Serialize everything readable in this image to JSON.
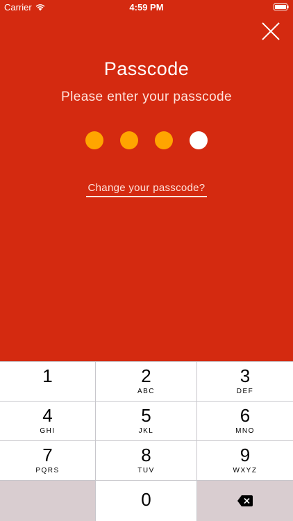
{
  "status_bar": {
    "carrier": "Carrier",
    "time": "4:59 PM"
  },
  "title": "Passcode",
  "subtitle": "Please enter your passcode",
  "passcode": {
    "length": 4,
    "entered": 3,
    "filled_color": "#FFA500",
    "empty_color": "#FFFFFF"
  },
  "change_link": "Change your passcode?",
  "colors": {
    "background": "#D42A10",
    "keypad_special": "#D9CDD0"
  },
  "keypad": {
    "keys": [
      {
        "num": "1",
        "letters": ""
      },
      {
        "num": "2",
        "letters": "ABC"
      },
      {
        "num": "3",
        "letters": "DEF"
      },
      {
        "num": "4",
        "letters": "GHI"
      },
      {
        "num": "5",
        "letters": "JKL"
      },
      {
        "num": "6",
        "letters": "MNO"
      },
      {
        "num": "7",
        "letters": "PQRS"
      },
      {
        "num": "8",
        "letters": "TUV"
      },
      {
        "num": "9",
        "letters": "WXYZ"
      },
      {
        "num": "0",
        "letters": ""
      }
    ]
  },
  "icons": {
    "close": "close-icon",
    "delete": "backspace-icon",
    "wifi": "wifi-icon",
    "battery": "battery-icon"
  }
}
